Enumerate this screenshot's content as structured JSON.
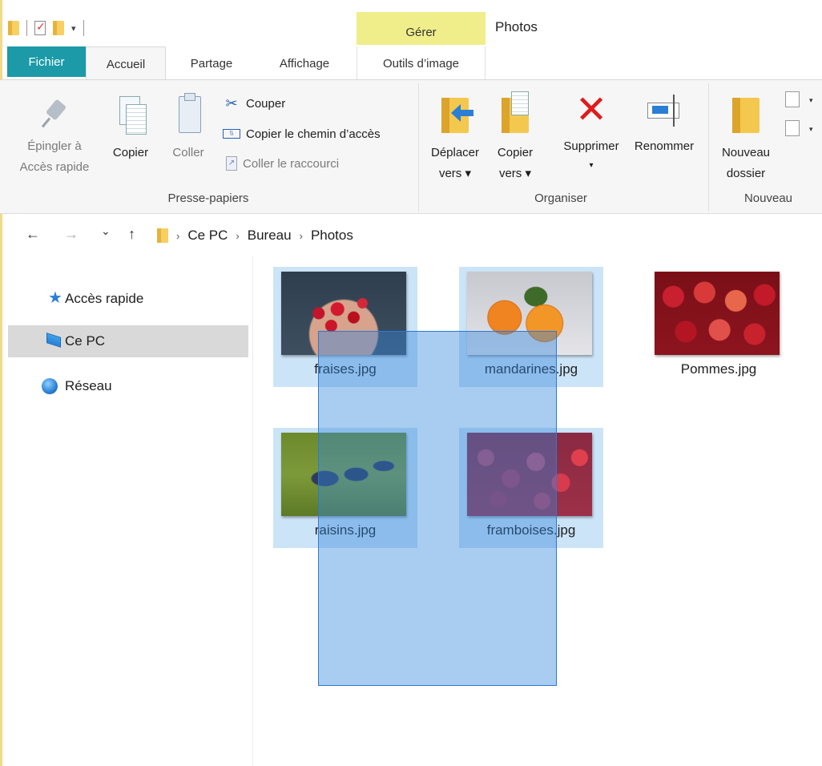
{
  "quick_access_toolbar": {
    "dropdown_glyph": "▾"
  },
  "contextual_tab_header": {
    "label": "Gérer"
  },
  "window": {
    "title": "Photos"
  },
  "tabs": [
    {
      "label": "Fichier"
    },
    {
      "label": "Accueil"
    },
    {
      "label": "Partage"
    },
    {
      "label": "Affichage"
    },
    {
      "label": "Outils d’image"
    }
  ],
  "ribbon": {
    "clipboard": {
      "group_label": "Presse-papiers",
      "pin": {
        "line1": "Épingler à",
        "line2": "Accès rapide",
        "icon": "pin-icon"
      },
      "copy": {
        "label": "Copier",
        "icon": "copy-icon"
      },
      "paste": {
        "label": "Coller",
        "icon": "paste-icon"
      },
      "cut": {
        "label": "Couper",
        "icon": "scissors-icon"
      },
      "copy_path": {
        "label": "Copier le chemin d’accès",
        "icon": "copy-path-icon"
      },
      "paste_shortcut": {
        "label": "Coller le raccourci",
        "icon": "paste-shortcut-icon"
      }
    },
    "organize": {
      "group_label": "Organiser",
      "move_to": {
        "line1": "Déplacer",
        "line2": "vers ▾"
      },
      "copy_to": {
        "line1": "Copier",
        "line2": "vers ▾"
      },
      "delete": {
        "label": "Supprimer",
        "caret": "▾"
      },
      "rename": {
        "label": "Renommer"
      }
    },
    "new": {
      "group_label": "Nouveau",
      "new_folder": {
        "line1": "Nouveau",
        "line2": "dossier"
      }
    }
  },
  "address_bar": {
    "back": "←",
    "forward": "→",
    "recent": "⌄",
    "up": "↑",
    "breadcrumbs": [
      "Ce PC",
      "Bureau",
      "Photos"
    ],
    "separator": "›"
  },
  "nav_pane": {
    "items": [
      {
        "label": "Accès rapide",
        "icon": "star-icon",
        "selected": false
      },
      {
        "label": "Ce PC",
        "icon": "computer-icon",
        "selected": true
      },
      {
        "label": "Réseau",
        "icon": "network-icon",
        "selected": false
      }
    ]
  },
  "files": [
    {
      "name": "fraises.jpg",
      "selected": true
    },
    {
      "name": "mandarines.jpg",
      "selected": true
    },
    {
      "name": "Pommes.jpg",
      "selected": false
    },
    {
      "name": "raisins.jpg",
      "selected": true
    },
    {
      "name": "framboises.jpg",
      "selected": true
    }
  ],
  "colors": {
    "file_tab": "#1c9aa7",
    "contextual_tab": "#f0ee8a",
    "selection": "#cce4f7",
    "marquee": "#3385dd",
    "delete": "#e01b1b"
  }
}
